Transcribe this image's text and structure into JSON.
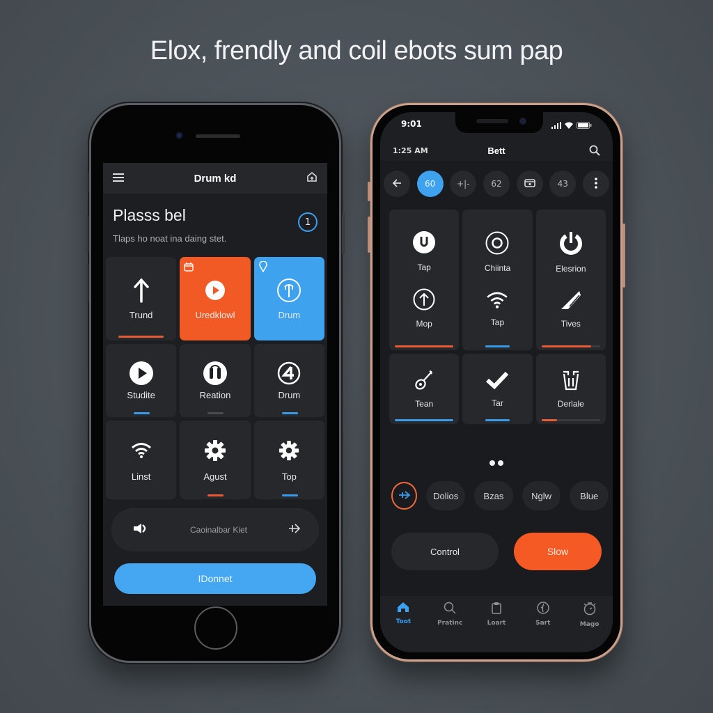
{
  "headline": "Elox, frendly and coil ebots sum pap",
  "colors": {
    "accent_orange": "#f25a25",
    "accent_blue": "#3ea2ef",
    "background": "#4a5157",
    "tile": "#27282c"
  },
  "left_phone": {
    "topbar": {
      "menu_icon": "hamburger-icon",
      "title": "Drum kd",
      "home_icon": "home-icon"
    },
    "header": {
      "title": "Plasss bel",
      "subtitle": "Tlaps ho noat ina daing stet.",
      "badge": "1"
    },
    "tiles": [
      {
        "label": "Trund",
        "icon": "arrow-up-icon",
        "style": "dark",
        "indicator": "orange",
        "progress": 1.0
      },
      {
        "label": "Uredklowl",
        "icon": "play-circle-icon",
        "style": "orange",
        "corner_icon": "calendar-icon"
      },
      {
        "label": "Drum",
        "icon": "tuning-fork-circle-icon",
        "style": "blue",
        "corner_icon": "location-pin-icon"
      },
      {
        "label": "Studite",
        "icon": "play-circle-icon",
        "style": "dark",
        "indicator": "blue",
        "progress": 0.25
      },
      {
        "label": "Reation",
        "icon": "headphones-icon",
        "style": "dark",
        "indicator": "gray",
        "progress": 0.25
      },
      {
        "label": "Drum",
        "icon": "number-four-circle-icon",
        "style": "dark",
        "indicator": "blue",
        "progress": 0.25
      },
      {
        "label": "Linst",
        "icon": "wifi-icon",
        "style": "dark"
      },
      {
        "label": "Agust",
        "icon": "gear-icon",
        "style": "dark",
        "indicator": "orange",
        "progress": 0.25
      },
      {
        "label": "Top",
        "icon": "gear-icon",
        "style": "dark",
        "indicator": "blue",
        "progress": 0.25
      }
    ],
    "control_bar": {
      "left_icon": "speaker-icon",
      "label": "Caoinalbar Kiet",
      "right_icon": "send-arrow-icon"
    },
    "primary_button": "IDonnet"
  },
  "right_phone": {
    "status": {
      "time": "9:01",
      "signal_icon": "signal-icon",
      "wifi_icon": "wifi-icon",
      "battery_icon": "battery-icon"
    },
    "nav": {
      "time_label": "1:25 AM",
      "title": "Bett",
      "search_icon": "search-icon"
    },
    "chips": [
      {
        "label": "",
        "icon": "back-arrow-icon",
        "active": false
      },
      {
        "label": "60",
        "active": true
      },
      {
        "label": "+|-",
        "active": false
      },
      {
        "label": "62",
        "active": false
      },
      {
        "label": "",
        "icon": "radio-icon",
        "active": false
      },
      {
        "label": "43",
        "active": false
      },
      {
        "label": "",
        "icon": "more-vertical-icon",
        "active": false
      }
    ],
    "tiles": [
      {
        "items": [
          {
            "label": "Tap",
            "icon": "power-circle-icon"
          },
          {
            "label": "Mop",
            "icon": "arrow-up-circle-icon"
          }
        ],
        "indicator": "orange",
        "progress": 1.0
      },
      {
        "items": [
          {
            "label": "Chiinta",
            "icon": "target-ring-icon"
          },
          {
            "label": "Tap",
            "icon": "wifi-icon"
          }
        ],
        "indicator": "blue",
        "progress": 0.35
      },
      {
        "items": [
          {
            "label": "Elesrion",
            "icon": "power-icon"
          },
          {
            "label": "Tives",
            "icon": "blade-icon"
          }
        ],
        "indicator": "orange",
        "progress": 0.85
      },
      {
        "items": [
          {
            "label": "Tean",
            "icon": "guitar-icon"
          }
        ],
        "indicator": "blue",
        "progress": 1.0
      },
      {
        "items": [
          {
            "label": "Tar",
            "icon": "check-icon"
          }
        ],
        "indicator": "blue",
        "progress": 0.35
      },
      {
        "items": [
          {
            "label": "Derlale",
            "icon": "bucket-icon"
          }
        ],
        "indicator": "orange",
        "progress": 0.27
      }
    ],
    "page_dots": 2,
    "pills": {
      "icon": "forward-arrow-icon",
      "labels": [
        "Dolios",
        "Bzas",
        "Nglw",
        "Blue"
      ]
    },
    "actions": {
      "secondary": "Control",
      "primary": "Slow"
    },
    "tabs": [
      {
        "label": "Toot",
        "icon": "home-icon",
        "active": true
      },
      {
        "label": "Pratinc",
        "icon": "search-icon",
        "active": false
      },
      {
        "label": "Loart",
        "icon": "clipboard-icon",
        "active": false
      },
      {
        "label": "Sart",
        "icon": "tuning-circle-icon",
        "active": false
      },
      {
        "label": "Mago",
        "icon": "timer-icon",
        "active": false
      }
    ]
  }
}
